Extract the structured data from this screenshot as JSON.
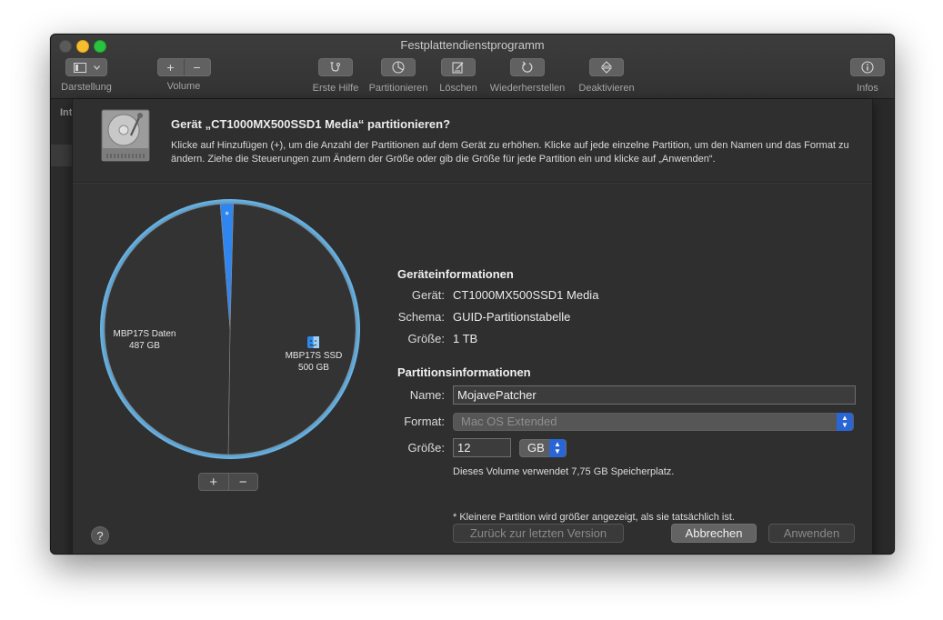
{
  "window": {
    "title": "Festplattendienstprogramm"
  },
  "toolbar": {
    "view_label": "Darstellung",
    "volume_label": "Volume",
    "volume_add": "+",
    "volume_remove": "−",
    "first_aid_label": "Erste Hilfe",
    "partition_label": "Partitionieren",
    "erase_label": "Löschen",
    "restore_label": "Wiederherstellen",
    "unmount_label": "Deaktivieren",
    "info_label": "Infos"
  },
  "sidebar": {
    "truncated_title": "Int"
  },
  "sheet": {
    "title": "Gerät „CT1000MX500SSD1 Media“ partitionieren?",
    "description": "Klicke auf Hinzufügen (+), um die Anzahl der Partitionen auf dem Gerät zu erhöhen. Klicke auf jede einzelne Partition, um den Namen und das Format zu ändern. Ziehe die Steuerungen zum Ändern der Größe oder gib die Größe für jede Partition ein und klicke auf „Anwenden“."
  },
  "pie": {
    "partitions": [
      {
        "name": "MBP17S SSD",
        "size_gb": 500,
        "size_label": "500 GB",
        "color": "#333333"
      },
      {
        "name": "MBP17S Daten",
        "size_gb": 487,
        "size_label": "487 GB",
        "color": "#333333"
      },
      {
        "name": "MojavePatcher",
        "size_gb": 12,
        "color": "#2f86f0",
        "star": "*"
      }
    ],
    "add": "+",
    "remove": "−"
  },
  "device_info": {
    "heading": "Geräteinformationen",
    "device_key": "Gerät:",
    "device_value": "CT1000MX500SSD1 Media",
    "scheme_key": "Schema:",
    "scheme_value": "GUID-Partitionstabelle",
    "size_key": "Größe:",
    "size_value": "1 TB"
  },
  "partition_info": {
    "heading": "Partitionsinformationen",
    "name_key": "Name:",
    "name_value": "MojavePatcher",
    "format_key": "Format:",
    "format_value": "Mac OS Extended",
    "size_key": "Größe:",
    "size_value": "12",
    "unit_value": "GB",
    "usage_note": "Dieses Volume verwendet 7,75 GB Speicherplatz."
  },
  "footnote": "* Kleinere Partition wird größer angezeigt, als sie tatsächlich ist.",
  "buttons": {
    "help": "?",
    "revert": "Zurück zur letzten Version",
    "cancel": "Abbrechen",
    "apply": "Anwenden"
  }
}
